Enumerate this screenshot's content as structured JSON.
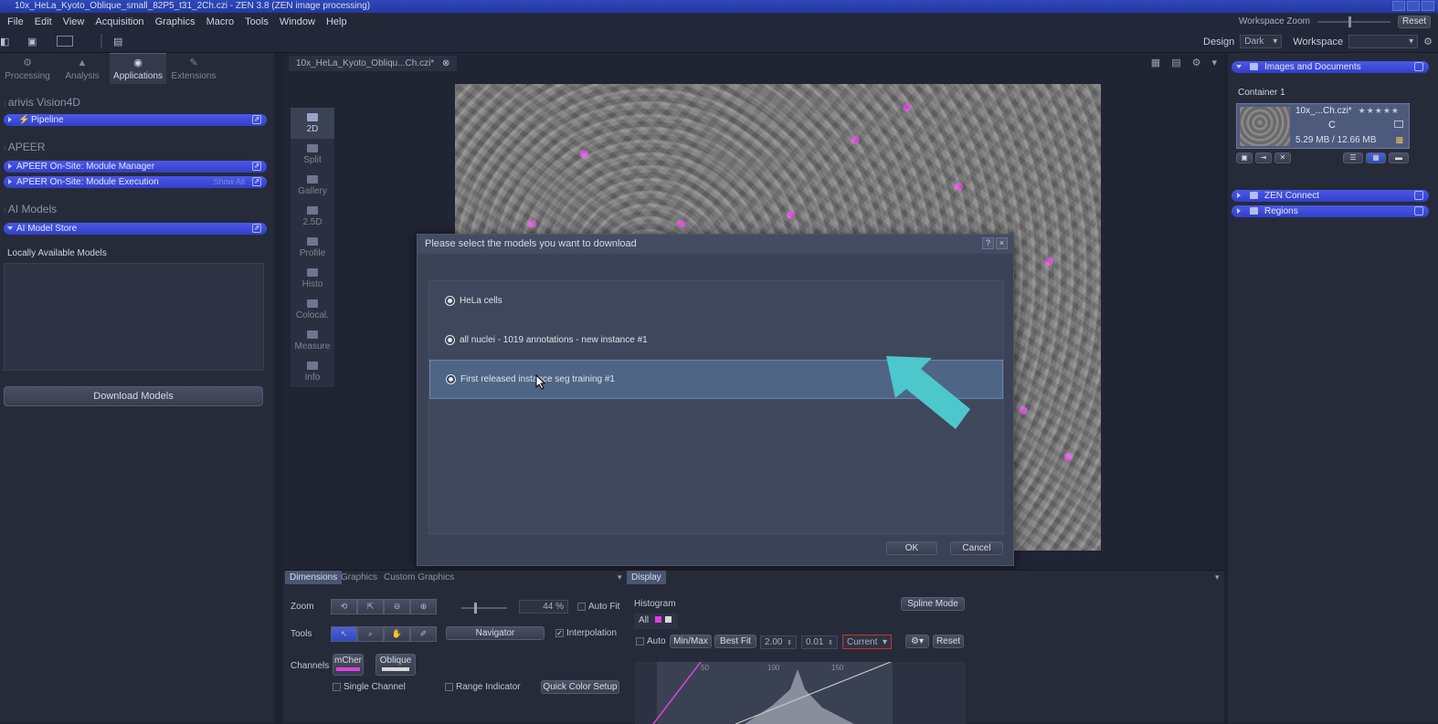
{
  "window": {
    "title": "10x_HeLa_Kyoto_Oblique_small_82P5_t31_2Ch.czi - ZEN 3.8 (ZEN image processing)"
  },
  "menu": [
    "File",
    "Edit",
    "View",
    "Acquisition",
    "Graphics",
    "Macro",
    "Tools",
    "Window",
    "Help"
  ],
  "workspace_zoom": {
    "label": "Workspace Zoom",
    "reset": "Reset"
  },
  "design": {
    "label": "Design",
    "value": "Dark",
    "workspace_label": "Workspace"
  },
  "left_tabs": [
    "Processing",
    "Analysis",
    "Applications",
    "Extensions"
  ],
  "left_sections": {
    "arivis": "arivis Vision4D",
    "pipeline": "Pipeline",
    "apeer": "APEER",
    "apeer_manager": "APEER On-Site: Module Manager",
    "apeer_execution": "APEER On-Site: Module Execution",
    "show_all": "Show All",
    "ai_models": "AI Models",
    "ai_store": "AI Model Store",
    "locally_available": "Locally Available Models",
    "download": "Download Models"
  },
  "view_buttons": [
    "2D",
    "Split",
    "Gallery",
    "2.5D",
    "Profile",
    "Histo",
    "Colocal.",
    "Measure",
    "Info"
  ],
  "doc_tab": "10x_HeLa_Kyoto_Obliqu...Ch.czi*",
  "dialog": {
    "title": "Please select the models you want to download",
    "help": "?",
    "close": "×",
    "models": [
      "HeLa cells",
      "all nuclei - 1019 annotations - new instance #1",
      "First released instance seg training #1"
    ],
    "ok": "OK",
    "cancel": "Cancel"
  },
  "bottom": {
    "tabs": [
      "Dimensions",
      "Graphics",
      "Custom Graphics"
    ],
    "display_tab": "Display",
    "zoom_label": "Zoom",
    "zoom_value": "44 %",
    "auto_fit": "Auto Fit",
    "tools_label": "Tools",
    "navigator": "Navigator",
    "interpolation": "Interpolation",
    "channels_label": "Channels",
    "channel1": "mCher",
    "channel2": "Oblique",
    "single_channel": "Single Channel",
    "range_indicator": "Range Indicator",
    "quick_color": "Quick Color Setup",
    "histogram": "Histogram",
    "spline_mode": "Spline Mode",
    "all": "All",
    "auto": "Auto",
    "minmax": "Min/Max",
    "bestfit": "Best Fit",
    "gamma": "2.00",
    "step": "0.01",
    "current": "Current",
    "reset": "Reset",
    "ticks": [
      "50",
      "100",
      "150"
    ]
  },
  "right": {
    "images_docs": "Images and Documents",
    "container": "Container 1",
    "file_name": "10x_...Ch.czi*",
    "file_letter": "C",
    "file_size": "5.29 MB / 12.66 MB",
    "zen_connect": "ZEN Connect",
    "regions": "Regions"
  },
  "colors": {
    "accent_blue": "#3f4fdc",
    "arrow": "#4cc8cc",
    "magenta": "#e040e0"
  }
}
